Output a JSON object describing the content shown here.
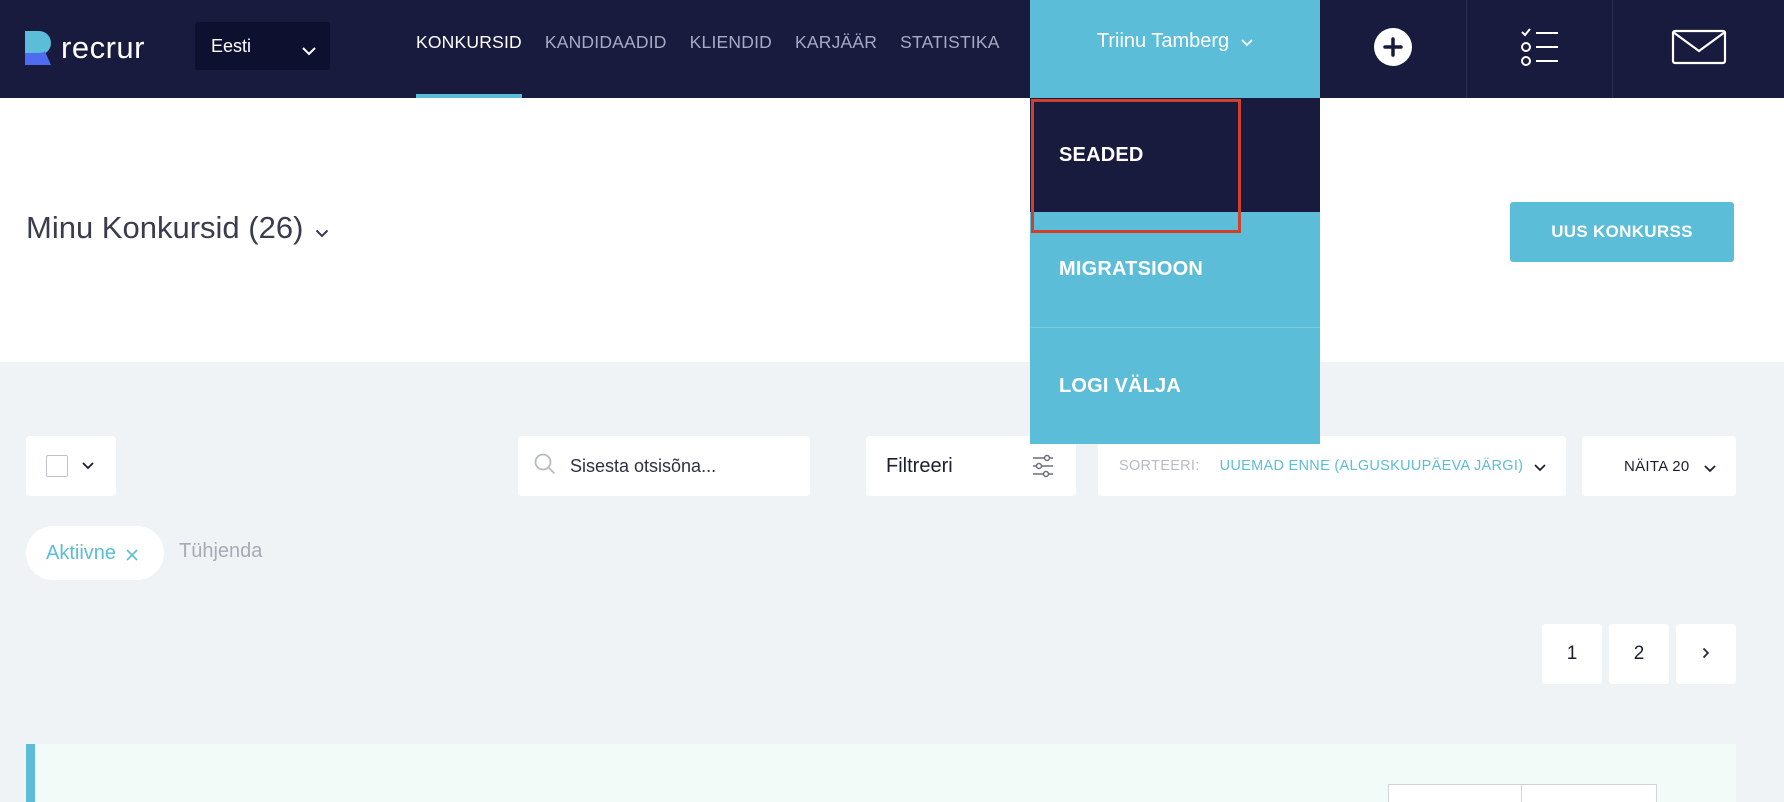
{
  "app": {
    "logo_text": "recrur"
  },
  "language": {
    "selected": "Eesti"
  },
  "nav": {
    "items": [
      {
        "label": "KONKURSID",
        "active": true
      },
      {
        "label": "KANDIDAADID",
        "active": false
      },
      {
        "label": "KLIENDID",
        "active": false
      },
      {
        "label": "KARJÄÄR",
        "active": false
      },
      {
        "label": "STATISTIKA",
        "active": false
      }
    ]
  },
  "user": {
    "name": "Triinu Tamberg"
  },
  "user_dropdown": {
    "items": [
      {
        "label": "SEADED"
      },
      {
        "label": "MIGRATSIOON"
      },
      {
        "label": "LOGI VÄLJA"
      }
    ]
  },
  "header_icons": [
    "plus-icon",
    "checklist-icon",
    "mail-icon"
  ],
  "page": {
    "title": "Minu Konkursid (26)",
    "new_button": "UUS KONKURSS"
  },
  "toolbar": {
    "search_placeholder": "Sisesta otsisõna...",
    "filter_label": "Filtreeri",
    "sort_label": "SORTEERI:",
    "sort_value": "UUEMAD ENNE (ALGUSKUUPÄEVA JÄRGI)",
    "show_label": "NÄITA 20"
  },
  "filters": {
    "active_chip": "Aktiivne",
    "clear_label": "Tühjenda"
  },
  "pagination": {
    "pages": [
      "1",
      "2"
    ]
  },
  "colors": {
    "nav_bg": "#181a3e",
    "accent": "#5bbdd8",
    "page_bg": "#eff3f6",
    "highlight": "#d0402b"
  }
}
